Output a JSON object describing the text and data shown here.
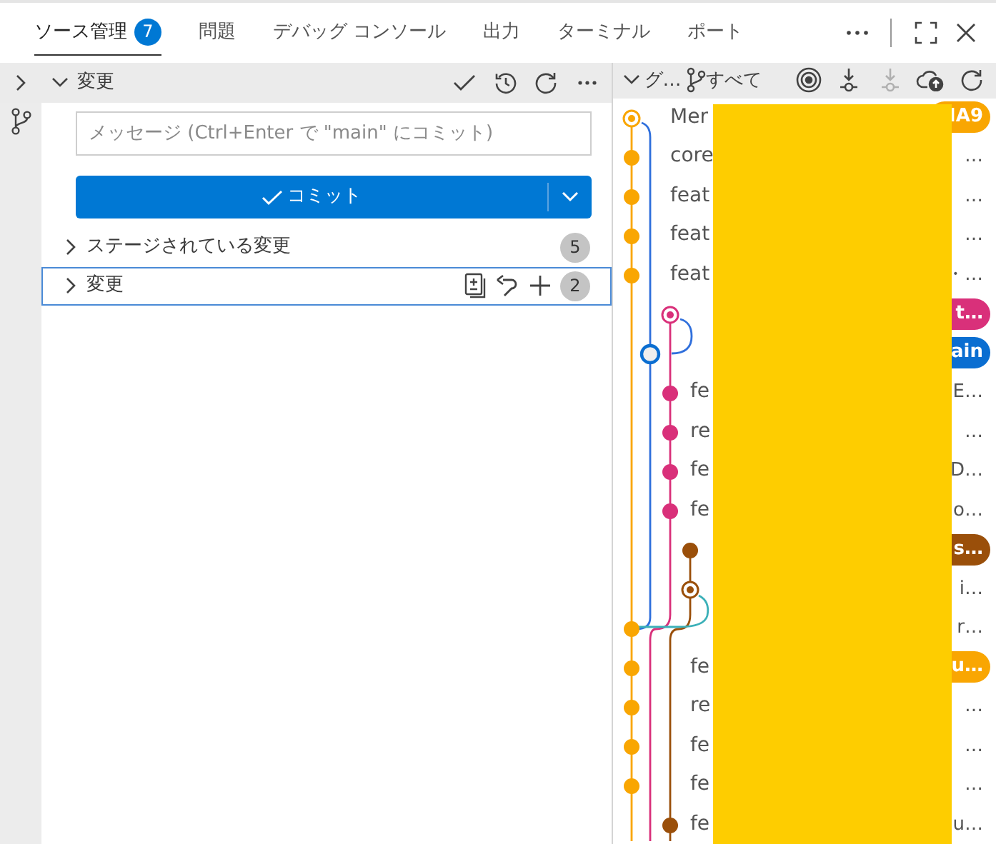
{
  "tabs": [
    {
      "label": "ソース管理",
      "selected": true,
      "badge": "7"
    },
    {
      "label": "問題",
      "selected": false
    },
    {
      "label": "デバッグ コンソール",
      "selected": false
    },
    {
      "label": "出力",
      "selected": false
    },
    {
      "label": "ターミナル",
      "selected": false
    },
    {
      "label": "ポート",
      "selected": false
    }
  ],
  "changes_panel": {
    "title": "変更",
    "message": {
      "placeholder": "メッセージ (Ctrl+Enter で \"main\" にコミット)"
    },
    "commit_button": "コミット",
    "groups": [
      {
        "label": "ステージされている変更",
        "count": "5",
        "focused": false
      },
      {
        "label": "変更",
        "count": "2",
        "focused": true
      }
    ]
  },
  "graph_panel": {
    "title": "グ…",
    "filter": "すべて",
    "commits": [
      {
        "left": "Mer",
        "right": "IA9",
        "badge": true,
        "color": "#f9a602",
        "kind": "current"
      },
      {
        "left": "core",
        "right": "…",
        "badge": false,
        "color": "#f9a602",
        "kind": "dot"
      },
      {
        "left": "feat",
        "right": "…",
        "badge": false,
        "color": "#f9a602",
        "kind": "dot"
      },
      {
        "left": "feat",
        "right": "…",
        "badge": false,
        "color": "#f9a602",
        "kind": "dot"
      },
      {
        "left": "feat",
        "right": "・…",
        "badge": false,
        "color": "#f9a602",
        "kind": "dot"
      },
      {
        "right": "t…",
        "badge": true,
        "color": "#d9307a",
        "kind": "current"
      },
      {
        "right": "ain",
        "badge": true,
        "color": "#0a6ed1",
        "kind": "hollow"
      },
      {
        "left": "fe",
        "right": "E…",
        "badge": false,
        "color": "#d9307a",
        "kind": "dot"
      },
      {
        "left": "re",
        "right": "…",
        "badge": false,
        "color": "#d9307a",
        "kind": "dot"
      },
      {
        "left": "fe",
        "right": "D…",
        "badge": false,
        "color": "#d9307a",
        "kind": "dot"
      },
      {
        "left": "fe",
        "right": "o…",
        "badge": false,
        "color": "#d9307a",
        "kind": "dot"
      },
      {
        "right": "s…",
        "badge": true,
        "color": "#9a4f0a",
        "kind": "dot"
      },
      {
        "right": "i…",
        "badge": false,
        "color": "#9a4f0a",
        "kind": "current"
      },
      {
        "right": "r…",
        "badge": false,
        "color": "#f9a602",
        "kind": "dot"
      },
      {
        "left": "fe",
        "right": "u…",
        "badge": true,
        "color": "#f9a602",
        "kind": "dot"
      },
      {
        "left": "re",
        "right": "…",
        "badge": false,
        "color": "#f9a602",
        "kind": "dot"
      },
      {
        "left": "fe",
        "right": "…",
        "badge": false,
        "color": "#f9a602",
        "kind": "dot"
      },
      {
        "left": "fe",
        "right": "…",
        "badge": false,
        "color": "#f9a602",
        "kind": "dot"
      },
      {
        "left": "fe",
        "right": "u…",
        "badge": false,
        "color": "#9a4f0a",
        "kind": "dot"
      }
    ]
  }
}
